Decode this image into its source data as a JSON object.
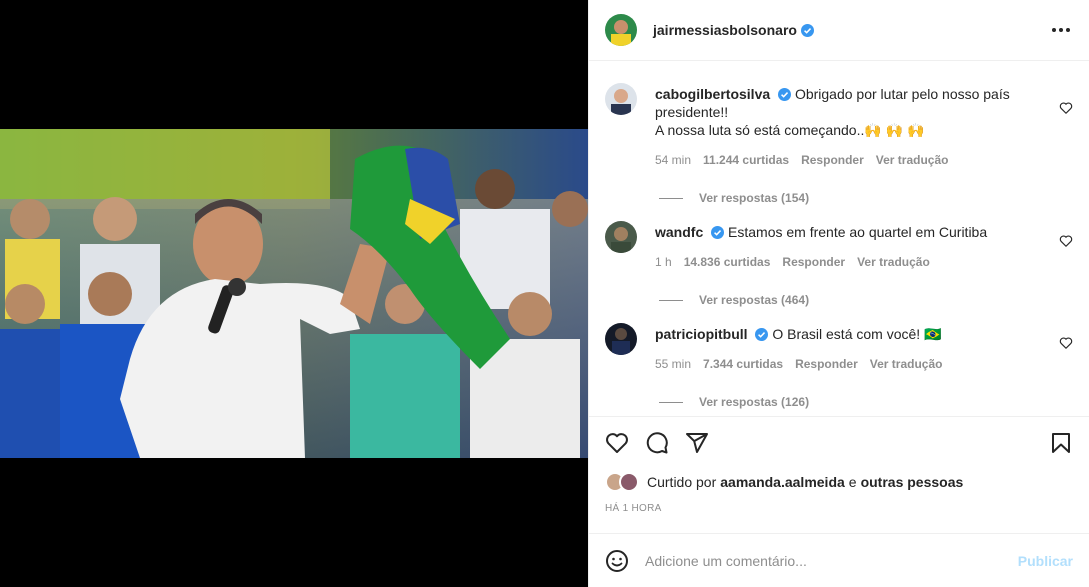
{
  "post": {
    "author": "jairmessiasbolsonaro",
    "author_verified": true
  },
  "comments": [
    {
      "user": "cabogilbertosilva",
      "verified": true,
      "text": "Obrigado por lutar pelo nosso país presidente!!",
      "text2": "A nossa luta só está começando..🙌 🙌 🙌",
      "time": "54 min",
      "likes": "11.244 curtidas",
      "reply_label": "Responder",
      "translate_label": "Ver tradução",
      "view_replies": "Ver respostas (154)"
    },
    {
      "user": "wandfc",
      "verified": true,
      "text": "Estamos em frente ao quartel em Curitiba",
      "time": "1 h",
      "likes": "14.836 curtidas",
      "reply_label": "Responder",
      "translate_label": "Ver tradução",
      "view_replies": "Ver respostas (464)"
    },
    {
      "user": "patriciopitbull",
      "verified": true,
      "text": "O Brasil está com você! 🇧🇷",
      "time": "55 min",
      "likes": "7.344 curtidas",
      "reply_label": "Responder",
      "translate_label": "Ver tradução",
      "view_replies": "Ver respostas (126)"
    }
  ],
  "likes_summary": {
    "prefix": "Curtido por",
    "user": "aamanda.aalmeida",
    "connector": "e",
    "others": "outras pessoas"
  },
  "timestamp": "HÁ 1 HORA",
  "comment_box": {
    "placeholder": "Adicione um comentário...",
    "publish_label": "Publicar"
  },
  "colors": {
    "verified": "#3897f0",
    "publish_disabled": "#b2dffc",
    "secondary_text": "#8e8e8e"
  },
  "icons": [
    "more-icon",
    "heart-icon",
    "comment-icon",
    "share-icon",
    "bookmark-icon",
    "emoji-icon",
    "verified-badge-icon"
  ]
}
